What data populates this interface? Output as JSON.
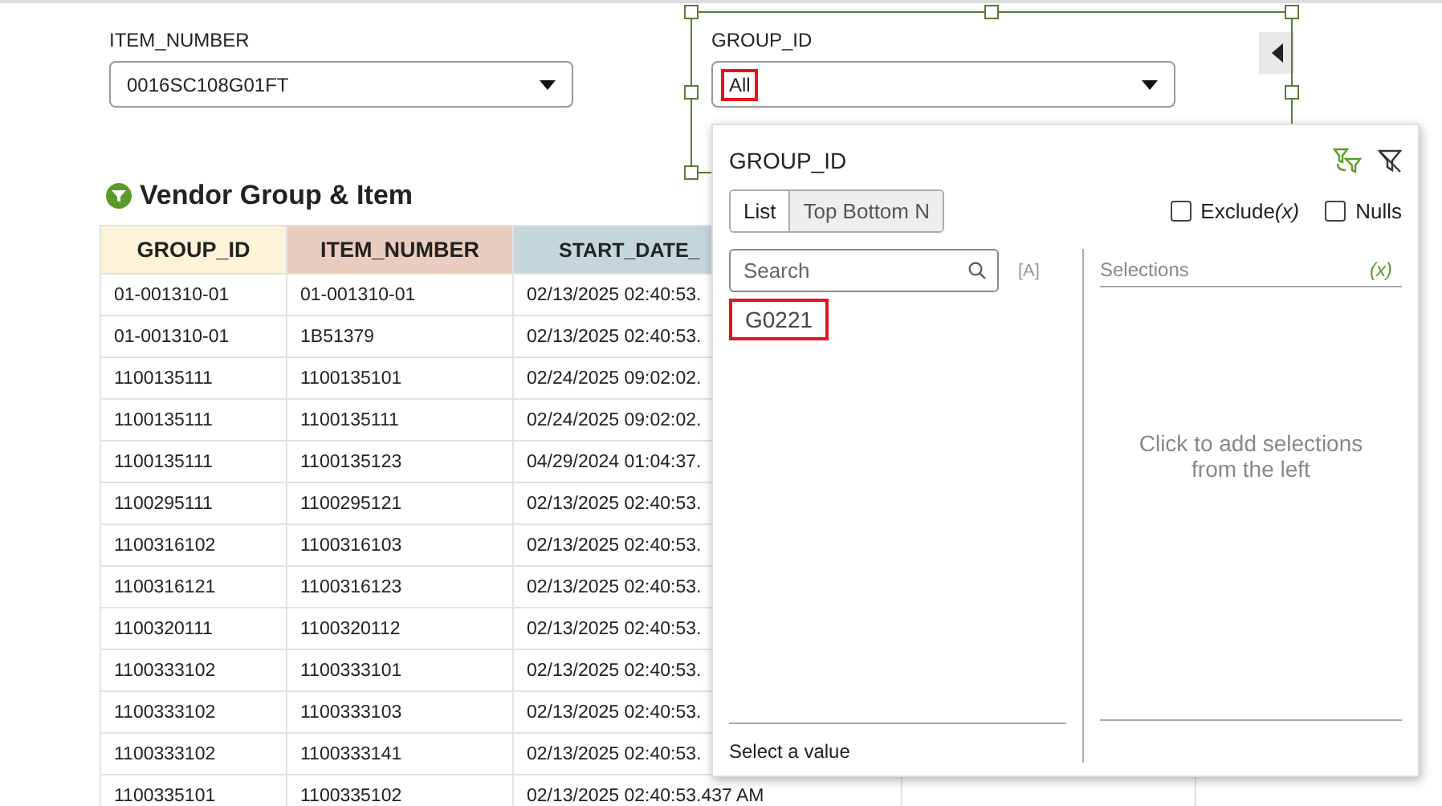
{
  "filters": [
    {
      "label": "ITEM_NUMBER",
      "value": "0016SC108G01FT",
      "highlighted": false,
      "framed": false
    },
    {
      "label": "GROUP_ID",
      "value": "All",
      "highlighted": true,
      "framed": true
    }
  ],
  "table": {
    "title": "Vendor Group & Item",
    "columns": [
      {
        "label": "GROUP_ID",
        "color": "#fdf3d8"
      },
      {
        "label": "ITEM_NUMBER",
        "color": "#ebcdbf"
      },
      {
        "label": "START_DATE_",
        "color": "#c5d6da"
      }
    ],
    "rows": [
      [
        "01-001310-01",
        "01-001310-01",
        "02/13/2025 02:40:53."
      ],
      [
        "01-001310-01",
        "1B51379",
        "02/13/2025 02:40:53."
      ],
      [
        "1100135111",
        "1100135101",
        "02/24/2025 09:02:02."
      ],
      [
        "1100135111",
        "1100135111",
        "02/24/2025 09:02:02."
      ],
      [
        "1100135111",
        "1100135123",
        "04/29/2024 01:04:37."
      ],
      [
        "1100295111",
        "1100295121",
        "02/13/2025 02:40:53."
      ],
      [
        "1100316102",
        "1100316103",
        "02/13/2025 02:40:53."
      ],
      [
        "1100316121",
        "1100316123",
        "02/13/2025 02:40:53."
      ],
      [
        "1100320111",
        "1100320112",
        "02/13/2025 02:40:53."
      ],
      [
        "1100333102",
        "1100333101",
        "02/13/2025 02:40:53."
      ],
      [
        "1100333102",
        "1100333103",
        "02/13/2025 02:40:53."
      ],
      [
        "1100333102",
        "1100333141",
        "02/13/2025 02:40:53."
      ],
      [
        "1100335101",
        "1100335102",
        "02/13/2025 02:40:53.437 AM"
      ]
    ]
  },
  "popup": {
    "title": "GROUP_ID",
    "tabs": [
      {
        "label": "List",
        "selected": true
      },
      {
        "label": "Top Bottom N",
        "selected": false
      }
    ],
    "options": [
      {
        "label": "Exclude",
        "suffix": "(x)",
        "checked": false
      },
      {
        "label": "Nulls",
        "checked": false
      }
    ],
    "search": {
      "placeholder": "Search"
    },
    "case_toggle": "[A]",
    "values": [
      {
        "label": "G0221",
        "highlighted": true
      }
    ],
    "selections_label": "Selections",
    "selections_suffix": "(x)",
    "empty_message": "Click to add selections from the left",
    "footer": "Select a value"
  }
}
